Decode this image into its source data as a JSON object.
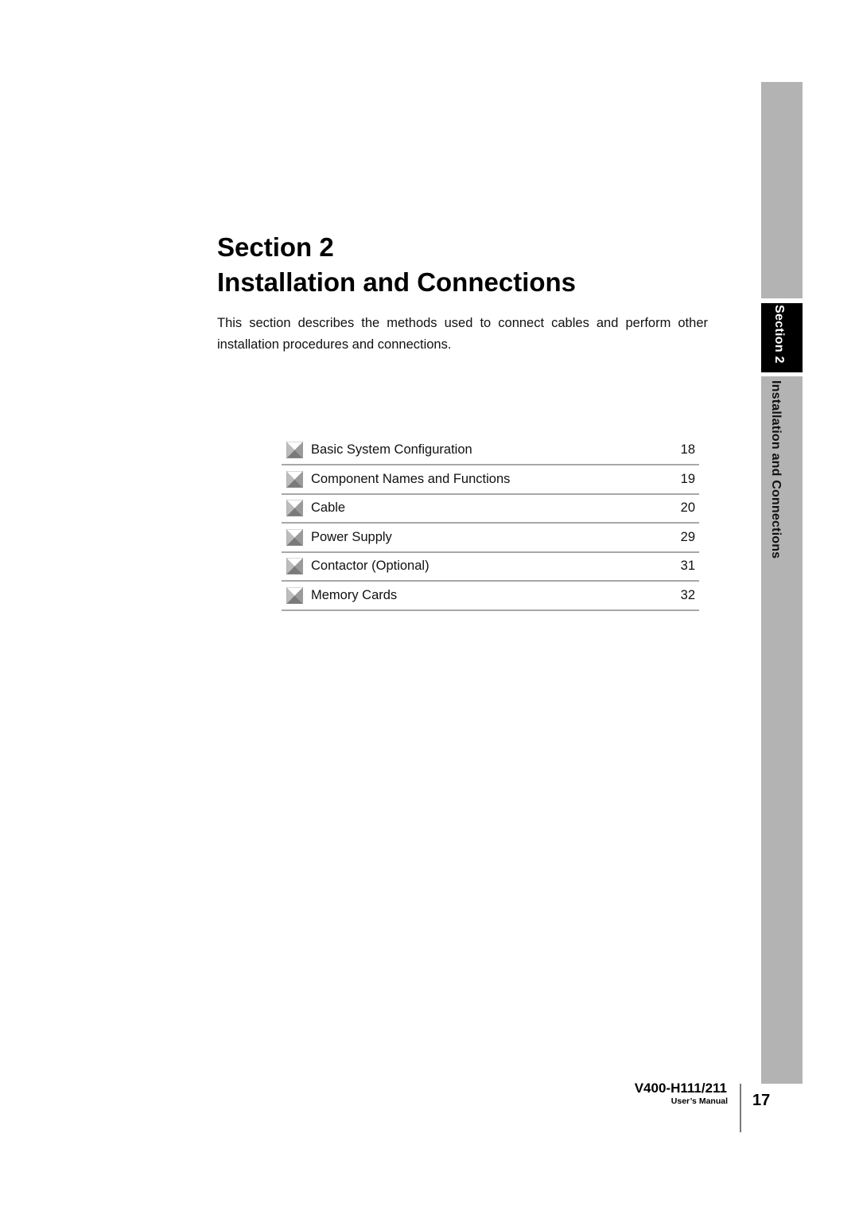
{
  "heading": {
    "line1": "Section 2",
    "line2": "Installation and Connections"
  },
  "intro": "This section describes the methods used to connect cables and perform other installation procedures and connections.",
  "toc": {
    "icon": "pyramid-bullet-icon",
    "items": [
      {
        "label": "Basic System Configuration",
        "page": "18"
      },
      {
        "label": "Component Names and Functions",
        "page": "19"
      },
      {
        "label": "Cable",
        "page": "20"
      },
      {
        "label": "Power Supply",
        "page": "29"
      },
      {
        "label": "Contactor (Optional)",
        "page": "31"
      },
      {
        "label": "Memory Cards",
        "page": "32"
      }
    ]
  },
  "side_tab": {
    "section": "Section 2",
    "title": "Installation and Connections"
  },
  "footer": {
    "model": "V400-H111/211",
    "subtitle": "User’s Manual",
    "page_number": "17"
  },
  "colors": {
    "side_bar": "#b3b3b3",
    "active_tab": "#000000",
    "divider": "#a8a8a8"
  }
}
